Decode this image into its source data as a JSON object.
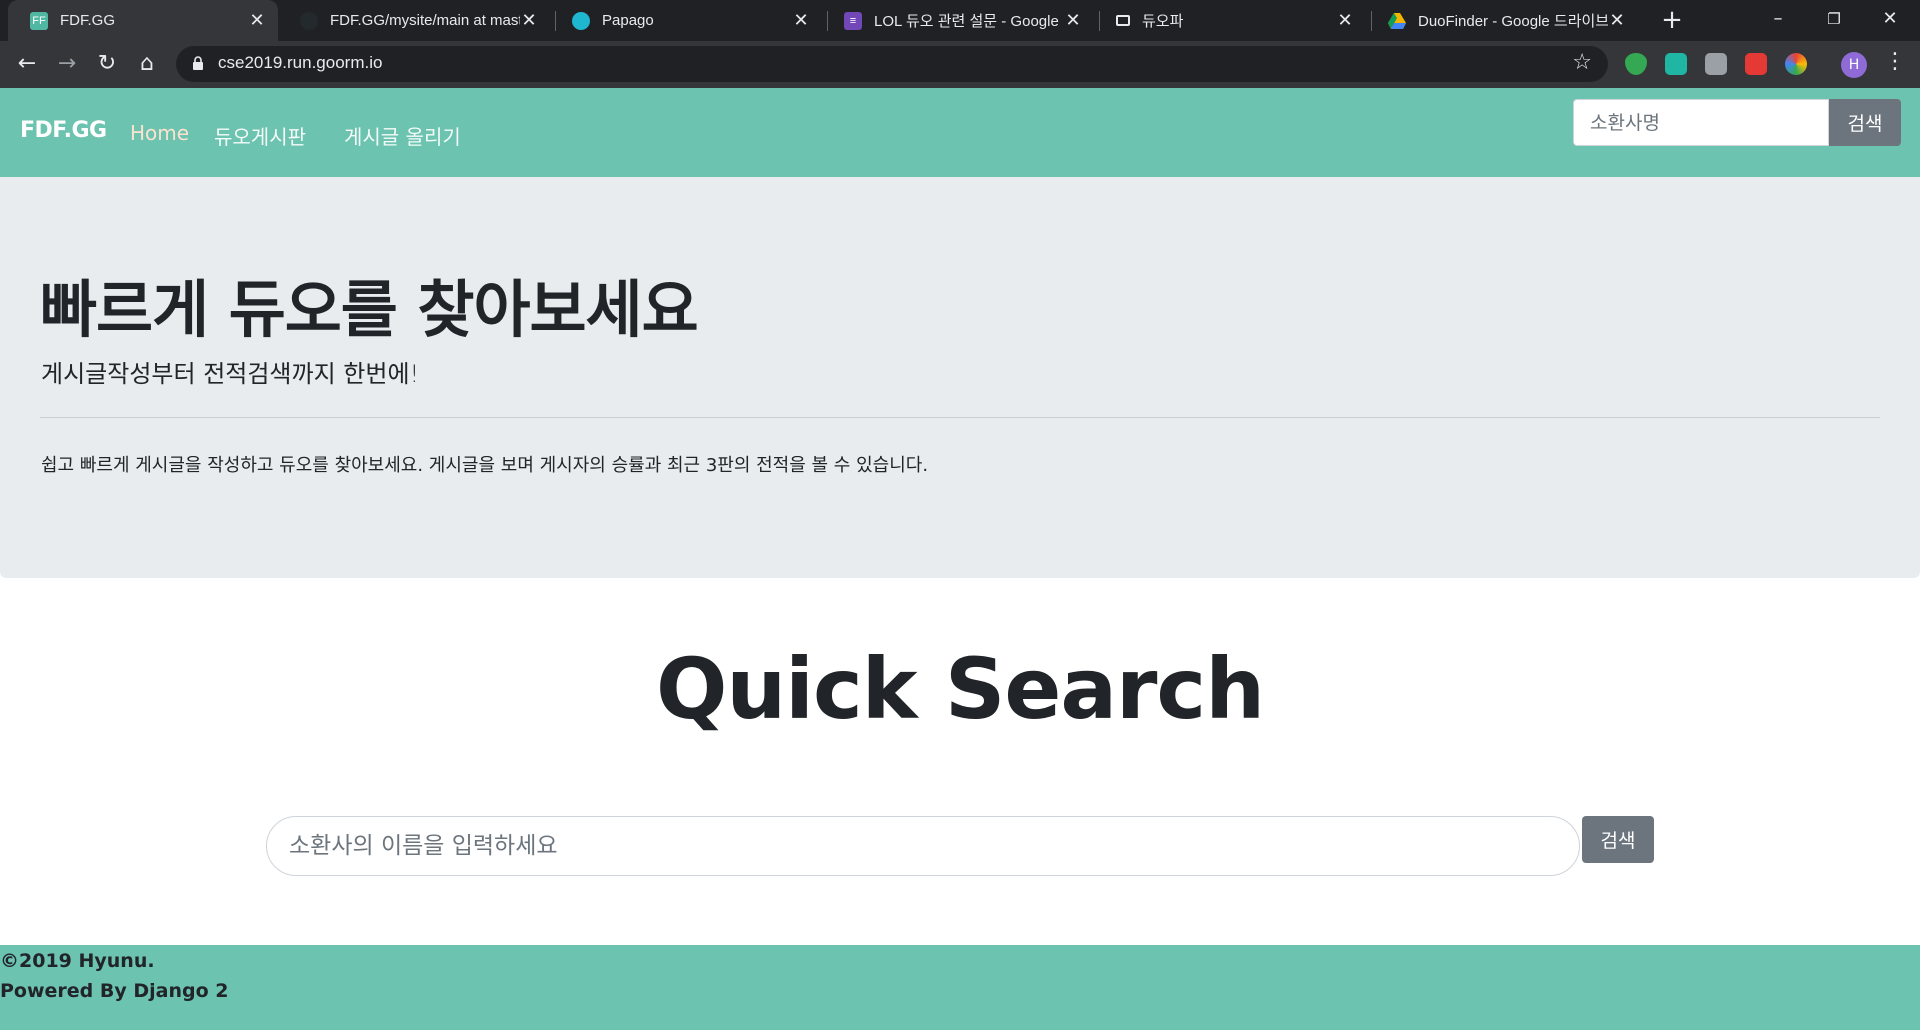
{
  "browser": {
    "tabs": [
      {
        "title": "FDF.GG",
        "active": true
      },
      {
        "title": "FDF.GG/mysite/main at maste"
      },
      {
        "title": "Papago"
      },
      {
        "title": "LOL 듀오 관련 설문 - Google"
      },
      {
        "title": "듀오파"
      },
      {
        "title": "DuoFinder - Google 드라이브"
      }
    ],
    "url": "cse2019.run.goorm.io",
    "profile_initial": "H"
  },
  "navbar": {
    "brand": "FDF.GG",
    "links": [
      "Home",
      "듀오게시판",
      "게시글 올리기"
    ],
    "search_placeholder": "소환사명",
    "search_button": "검색",
    "bg_color": "#6cc3af"
  },
  "jumbotron": {
    "title": "빠르게 듀오를 찾아보세요",
    "lead": "게시글작성부터 전적검색까지 한번에!",
    "description": "쉽고 빠르게 게시글을 작성하고 듀오를 찾아보세요. 게시글을 보며 게시자의 승률과 최근 3판의 전적을 볼 수 있습니다."
  },
  "quick_search": {
    "title": "Quick Search",
    "placeholder": "소환사의 이름을 입력하세요",
    "button": "검색"
  },
  "footer": {
    "line1": "©2019 Hyunu.",
    "line2": "Powered By Django 2"
  }
}
